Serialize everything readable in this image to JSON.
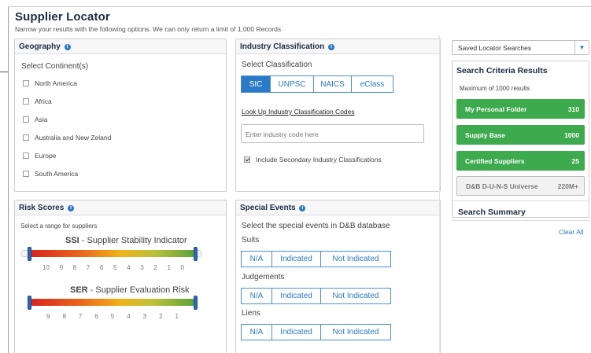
{
  "header": {
    "title": "Supplier Locator",
    "subtitle": "Narrow your results with the following options. We can only return a limit of 1,000 Records"
  },
  "geography": {
    "title": "Geography",
    "continent_label": "Select Continent(s)",
    "continents": [
      "North America",
      "Africa",
      "Asia",
      "Australia and New Zeland",
      "Europe",
      "South America"
    ]
  },
  "industry": {
    "title": "Industry Classification",
    "select_label": "Select Classification",
    "tabs": [
      "SIC",
      "UNPSC",
      "NAICS",
      "eClass"
    ],
    "active_tab": "SIC",
    "lookup_link": "Look Up Industry Classification Codes",
    "input_placeholder": "Enter industry code here",
    "secondary_label": "Include Secondary Industry Classifications",
    "secondary_checked": true
  },
  "risk": {
    "title": "Risk Scores",
    "instruction": "Select a range for suppliers",
    "ssi": {
      "abbr": "SSI",
      "name": " - Supplier Stability Indicator",
      "ticks": [
        "10",
        "9",
        "8",
        "7",
        "6",
        "5",
        "4",
        "3",
        "2",
        "1",
        "0"
      ],
      "range": [
        10,
        0
      ]
    },
    "ser": {
      "abbr": "SER",
      "name": " - Supplier Evaluation Risk",
      "ticks": [
        "9",
        "8",
        "7",
        "6",
        "5",
        "4",
        "3",
        "2",
        "1"
      ],
      "range": [
        9,
        1
      ]
    }
  },
  "events": {
    "title": "Special Events",
    "instruction": "Select the special events in D&B database",
    "groups": [
      {
        "name": "Suits",
        "options": [
          "N/A",
          "Indicated",
          "Not Indicated"
        ]
      },
      {
        "name": "Judgements",
        "options": [
          "N/A",
          "Indicated",
          "Not Indicated"
        ]
      },
      {
        "name": "Liens",
        "options": [
          "N/A",
          "Indicated",
          "Not Indicated"
        ]
      }
    ]
  },
  "saved_searches": {
    "label": "Saved Locator Searches",
    "arrow_icon": "caret-down-icon"
  },
  "results": {
    "title": "Search Criteria Results",
    "note": "Maximum of 1000 results",
    "items": [
      {
        "label": "My Personal Folder",
        "count": "310"
      },
      {
        "label": "Supply Base",
        "count": "1000"
      },
      {
        "label": "Certified Suppliers",
        "count": "25"
      },
      {
        "label": "D&B D-U-N-S Universe",
        "count": "220M+"
      }
    ],
    "summary_title": "Search Summary",
    "clear_all": "Clear All"
  },
  "colors": {
    "accent": "#2b7ac8",
    "green": "#3daa4e",
    "title": "#1c2b45"
  }
}
